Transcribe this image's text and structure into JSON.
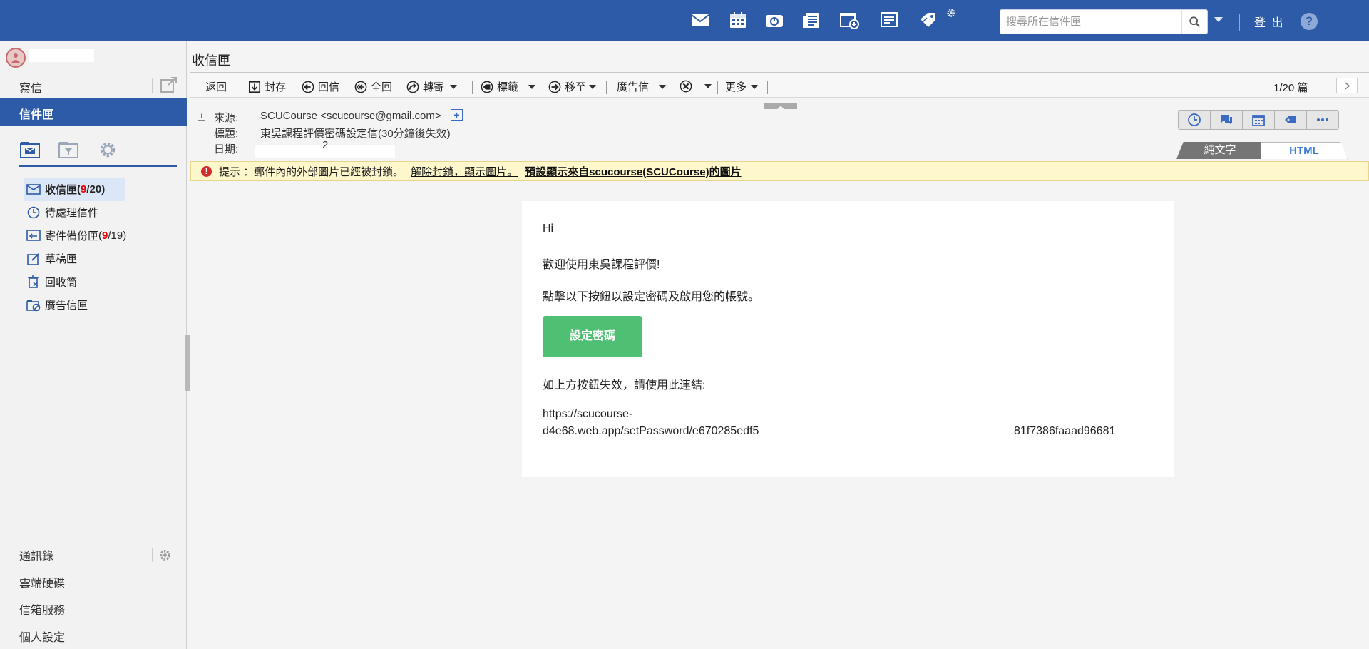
{
  "topbar": {
    "icons": [
      "mail-icon",
      "calendar-icon",
      "disk-icon",
      "newspaper-icon",
      "add-event-icon",
      "memo-icon",
      "tag-icon",
      "settings-icon"
    ],
    "search_placeholder": "搜尋所在信件匣",
    "logout": "登 出",
    "help": "?"
  },
  "sidebar": {
    "compose": "寫信",
    "mailbox_tab": "信件匣",
    "folders": [
      {
        "name": "收信匣",
        "unread": "9",
        "total": "/20",
        "open": "(",
        "close": ")"
      },
      {
        "name": "待處理信件"
      },
      {
        "name": "寄件備份匣",
        "unread": "9",
        "total": "/19",
        "open": "(",
        "close": ")"
      },
      {
        "name": "草稿匣"
      },
      {
        "name": "回收筒"
      },
      {
        "name": "廣告信匣"
      }
    ],
    "bottom": [
      "通訊錄",
      "雲端硬碟",
      "信箱服務",
      "個人設定"
    ]
  },
  "main": {
    "title": "收信匣",
    "toolbar": {
      "back": "返回",
      "archive": "封存",
      "reply": "回信",
      "reply_all": "全回",
      "forward": "轉寄",
      "label": "標籤",
      "move": "移至",
      "spam": "廣告信",
      "more": "更多",
      "page": "1/20 篇"
    },
    "header": {
      "from_label": "來源:",
      "from_value": "SCUCourse <scucourse@gmail.com>",
      "subject_label": "標題:",
      "subject_value": "東吳課程評價密碼設定信(30分鐘後失效)",
      "date_label": "日期:",
      "date_value": "2"
    },
    "view_tabs": {
      "plain": "純文字",
      "html": "HTML"
    },
    "notice": {
      "prefix": "提示 ：郵件內的外部圖片已經被封鎖。",
      "unblock": "解除封鎖，顯示圖片。",
      "always": "預設顯示來自scucourse(SCUCourse)的圖片"
    },
    "email": {
      "greeting": "Hi",
      "welcome": "歡迎使用東吳課程評價!",
      "instruction": "點擊以下按鈕以設定密碼及啟用您的帳號。",
      "button": "設定密碼",
      "fallback": "如上方按鈕失效，請使用此連結:",
      "link_line1": "https://scucourse-",
      "link_line2_start": "d4e68.web.app/setPassword/e670285edf5",
      "link_line2_end": "81f7386faaad96681"
    }
  },
  "colors": {
    "brand": "#2e5ba7",
    "button": "#4ebf73",
    "notice_bg": "#fff7cc",
    "unread": "#e00000"
  }
}
